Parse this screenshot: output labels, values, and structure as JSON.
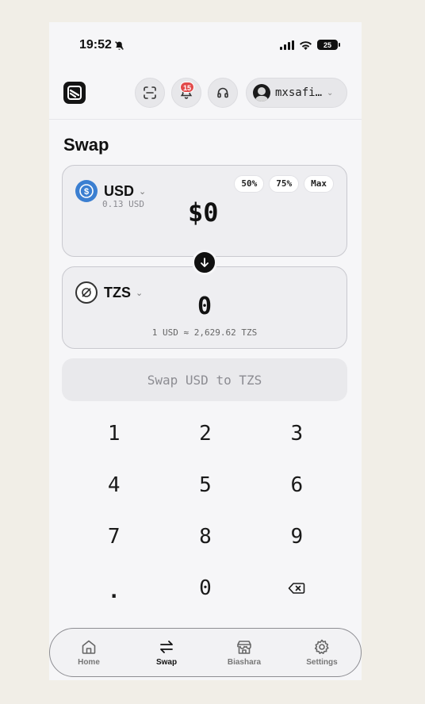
{
  "status_bar": {
    "time": "19:52",
    "battery": "25"
  },
  "header": {
    "notification_count": "15",
    "profile_name": "mxsafi…"
  },
  "page": {
    "title": "Swap"
  },
  "from_card": {
    "currency": "USD",
    "balance": "0.13 USD",
    "amount": "$0",
    "percent_buttons": [
      "50%",
      "75%",
      "Max"
    ]
  },
  "to_card": {
    "currency": "TZS",
    "amount": "0",
    "rate": "1 USD ≈ 2,629.62 TZS"
  },
  "swap_button": {
    "label": "Swap USD to TZS"
  },
  "keypad": {
    "rows": [
      [
        "1",
        "2",
        "3"
      ],
      [
        "4",
        "5",
        "6"
      ],
      [
        "7",
        "8",
        "9"
      ],
      [
        ".",
        "0",
        ""
      ]
    ]
  },
  "tabbar": {
    "items": [
      {
        "label": "Home",
        "icon": "home-icon"
      },
      {
        "label": "Swap",
        "icon": "swap-icon"
      },
      {
        "label": "Biashara",
        "icon": "store-icon"
      },
      {
        "label": "Settings",
        "icon": "gear-icon"
      }
    ],
    "active": "Swap"
  },
  "colors": {
    "accent": "#111111",
    "badge": "#e24a4a",
    "usd_icon": "#3b7fd1"
  }
}
